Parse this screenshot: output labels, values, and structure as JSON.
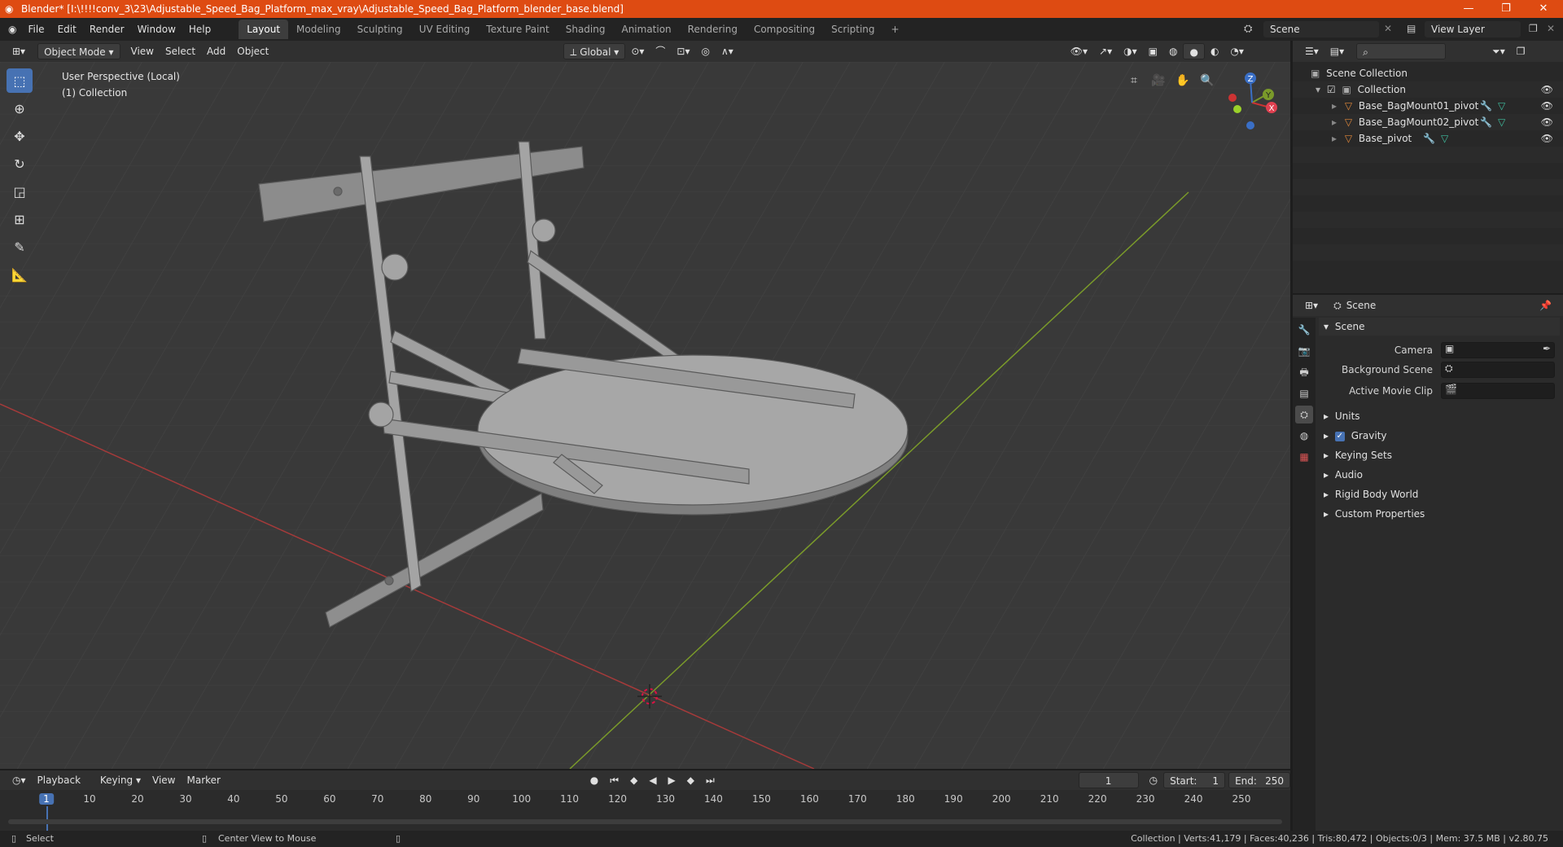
{
  "title": "Blender* [I:\\!!!!conv_3\\23\\Adjustable_Speed_Bag_Platform_max_vray\\Adjustable_Speed_Bag_Platform_blender_base.blend]",
  "window_controls": [
    "—",
    "❐",
    "✕"
  ],
  "menu": [
    "File",
    "Edit",
    "Render",
    "Window",
    "Help"
  ],
  "workspaces": [
    "Layout",
    "Modeling",
    "Sculpting",
    "UV Editing",
    "Texture Paint",
    "Shading",
    "Animation",
    "Rendering",
    "Compositing",
    "Scripting"
  ],
  "add_workspace": "+",
  "scene_name": "Scene",
  "view_layer": "View Layer",
  "viewport_header": {
    "mode": "Object Mode",
    "menus": [
      "View",
      "Select",
      "Add",
      "Object"
    ],
    "orientation": "Global"
  },
  "viewport_info": {
    "line1": "User Perspective (Local)",
    "line2": "(1) Collection"
  },
  "gizmo": {
    "x": "X",
    "y": "Y",
    "z": "Z"
  },
  "outliner": {
    "root": "Scene Collection",
    "collection": "Collection",
    "items": [
      "Base_BagMount01_pivot",
      "Base_BagMount02_pivot",
      "Base_pivot"
    ]
  },
  "properties": {
    "header": "Scene",
    "panel": "Scene",
    "fields": {
      "camera": "Camera",
      "background_scene": "Background Scene",
      "active_movie_clip": "Active Movie Clip"
    },
    "sections": [
      "Units",
      "Gravity",
      "Keying Sets",
      "Audio",
      "Rigid Body World",
      "Custom Properties"
    ],
    "gravity_checked": true
  },
  "timeline": {
    "menus": [
      "Playback",
      "Keying",
      "View",
      "Marker"
    ],
    "current_frame": "1",
    "start_label": "Start:",
    "start": "1",
    "end_label": "End:",
    "end": "250",
    "ticks": [
      "1",
      "10",
      "20",
      "30",
      "40",
      "50",
      "60",
      "70",
      "80",
      "90",
      "100",
      "110",
      "120",
      "130",
      "140",
      "150",
      "160",
      "170",
      "180",
      "190",
      "200",
      "210",
      "220",
      "230",
      "240",
      "250"
    ]
  },
  "status": {
    "left": "Select",
    "middle": "Center View to Mouse",
    "right": "Collection | Verts:41,179 | Faces:40,236 | Tris:80,472 | Objects:0/3 | Mem: 37.5 MB | v2.80.75"
  },
  "colors": {
    "titlebar": "#de4b12",
    "accent": "#4772b3",
    "x_axis": "#a53a3a",
    "y_axis": "#7a9a2a",
    "object_icon": "#e0883a"
  }
}
